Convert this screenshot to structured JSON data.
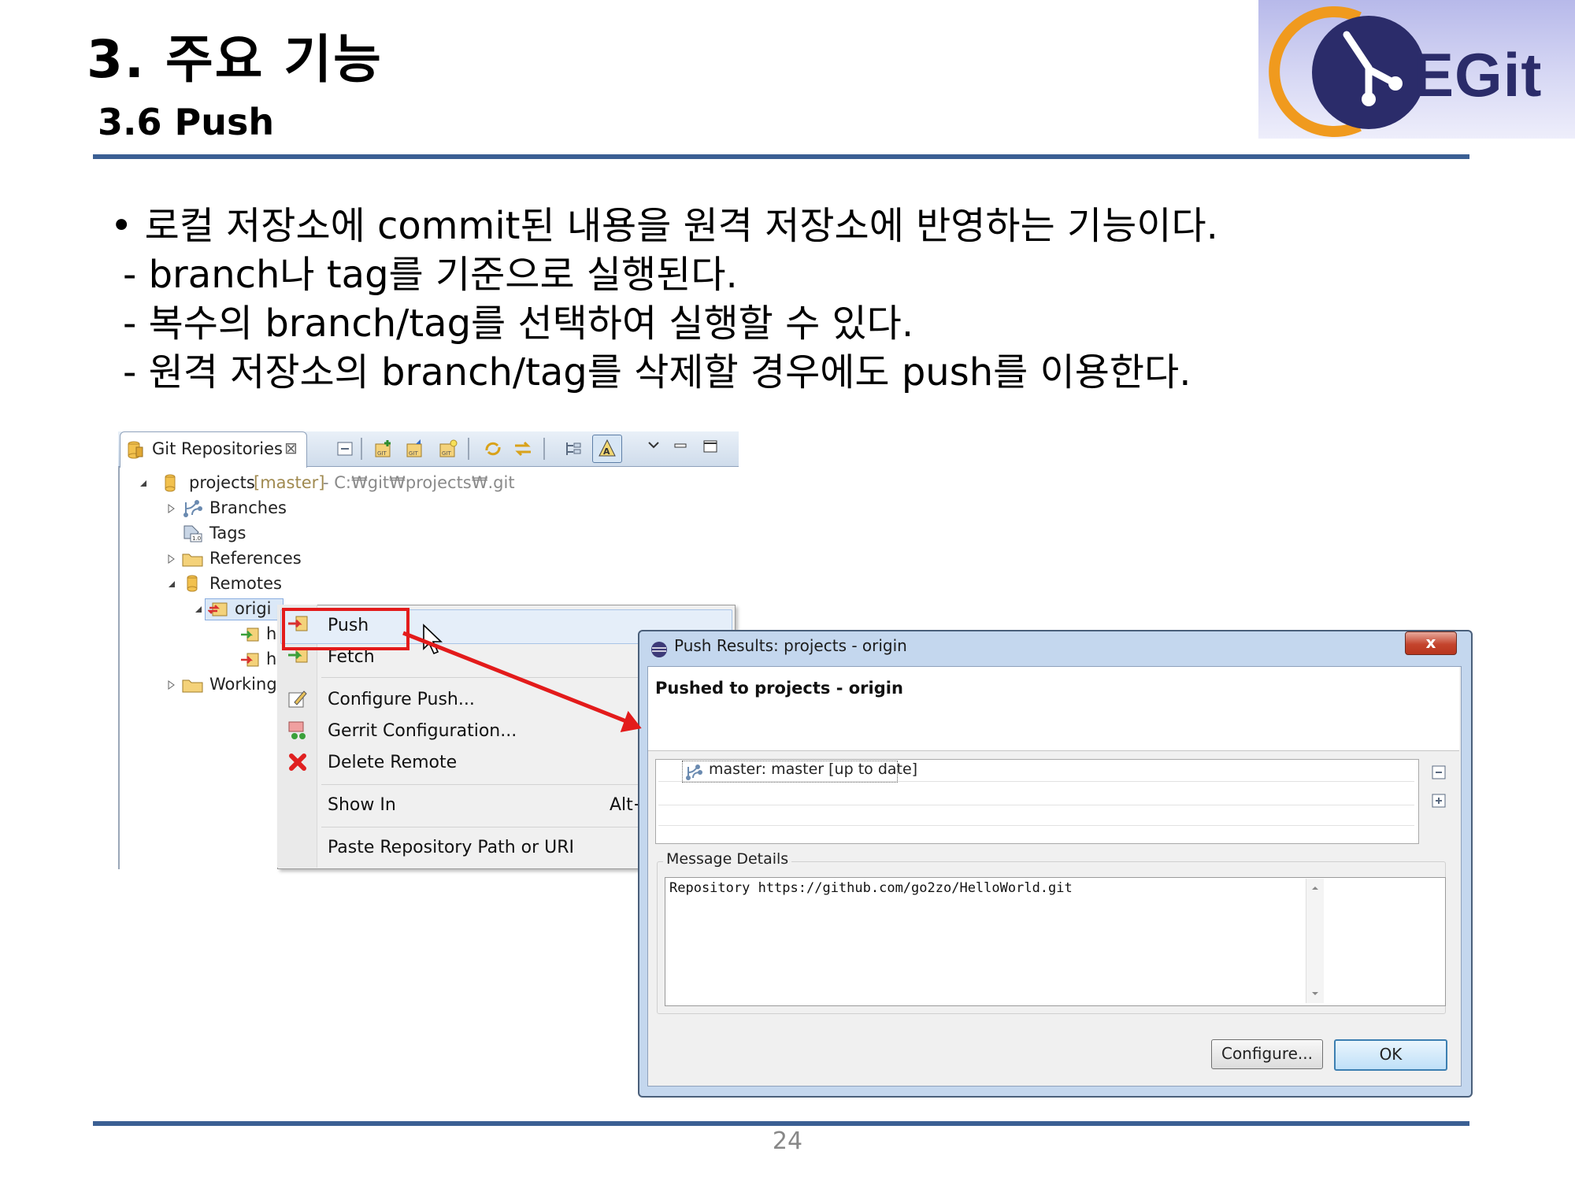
{
  "slide": {
    "title": "3. 주요 기능",
    "subtitle": "3.6 Push",
    "logo_text": "EGit",
    "page_number": "24",
    "bullets": [
      "•  로컬 저장소에 commit된 내용을 원격 저장소에 반영하는 기능이다.",
      "- branch나 tag를 기준으로 실행된다.",
      "- 복수의 branch/tag를 선택하여 실행할 수 있다.",
      "- 원격 저장소의 branch/tag를 삭제할 경우에도 push를 이용한다."
    ]
  },
  "git_view": {
    "tab_label": "Git Repositories",
    "tab_close": "⊠",
    "repo": {
      "name": "projects",
      "branch": "[master]",
      "path": "- C:₩git₩projects₩.git"
    },
    "nodes": {
      "branches": "Branches",
      "tags": "Tags",
      "references": "References",
      "remotes": "Remotes",
      "remote_origin": "origi",
      "child1": "h",
      "child2": "h",
      "working": "Working"
    }
  },
  "context_menu": {
    "items": {
      "push": "Push",
      "fetch": "Fetch",
      "configure_push": "Configure Push...",
      "gerrit": "Gerrit Configuration...",
      "delete_remote": "Delete Remote",
      "show_in": "Show In",
      "show_in_shortcut": "Alt+",
      "paste_path": "Paste Repository Path or URI"
    }
  },
  "dialog": {
    "title": "Push Results: projects - origin",
    "close_label": "x",
    "heading": "Pushed to projects - origin",
    "result_row": "master: master [up to date]",
    "message_group": "Message Details",
    "message": "Repository https://github.com/go2zo/HelloWorld.git",
    "configure_button": "Configure...",
    "ok_button": "OK"
  },
  "colors": {
    "accent_rule": "#3b5f93",
    "highlight_red": "#e31b1b",
    "logo_navy": "#2b2c6a",
    "logo_orange": "#f09a1e"
  }
}
